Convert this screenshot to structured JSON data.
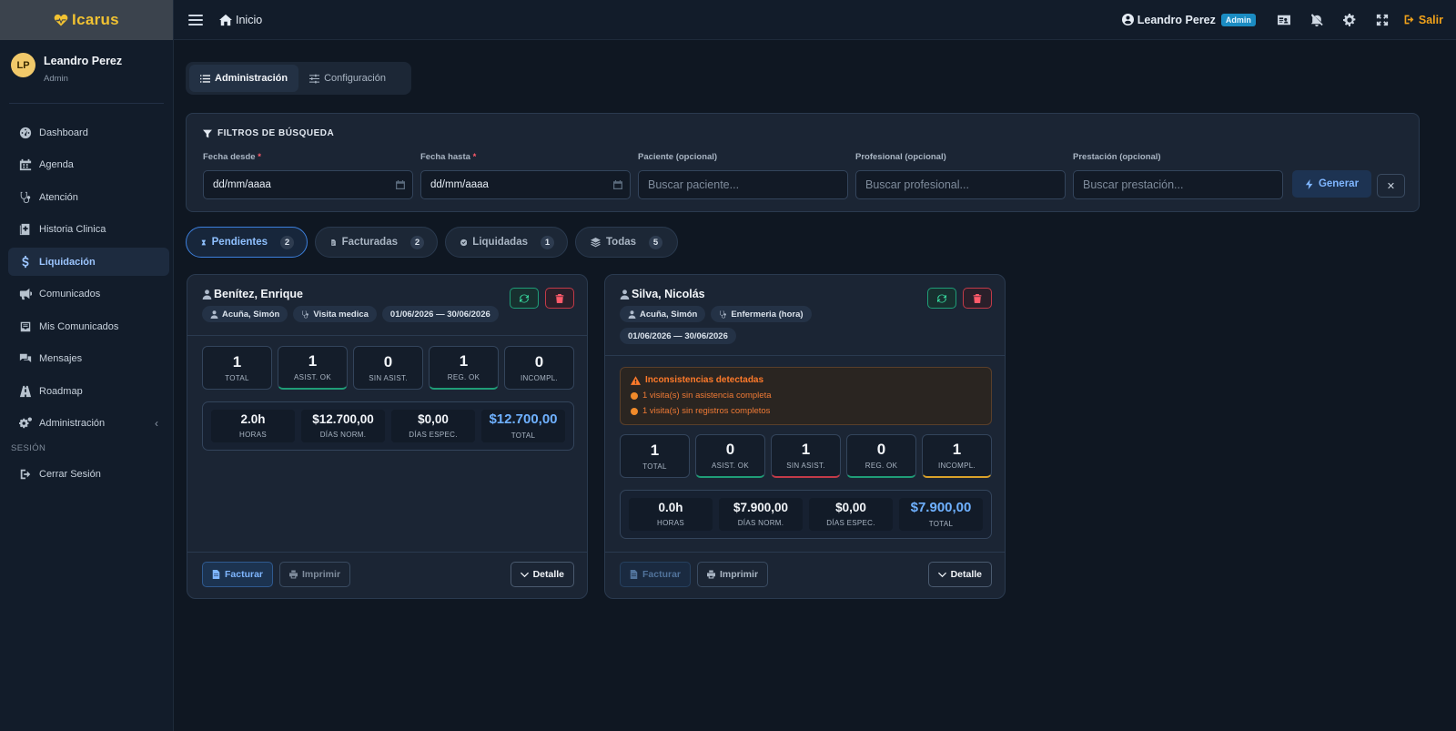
{
  "brand": {
    "name": "Icarus"
  },
  "sidebar": {
    "user": {
      "initials": "LP",
      "name": "Leandro Perez",
      "role": "Admin"
    },
    "items": [
      {
        "label": "Dashboard"
      },
      {
        "label": "Agenda"
      },
      {
        "label": "Atención"
      },
      {
        "label": "Historia Clinica"
      },
      {
        "label": "Liquidación"
      },
      {
        "label": "Comunicados"
      },
      {
        "label": "Mis Comunicados"
      },
      {
        "label": "Mensajes"
      },
      {
        "label": "Roadmap"
      },
      {
        "label": "Administración"
      }
    ],
    "session_label": "SESIÓN",
    "logout_label": "Cerrar Sesión"
  },
  "topbar": {
    "home_label": "Inicio",
    "user_name": "Leandro Perez",
    "user_badge": "Admin",
    "logout_label": "Salir"
  },
  "section_tabs": [
    {
      "label": "Administración"
    },
    {
      "label": "Configuración"
    }
  ],
  "filters": {
    "title": "FILTROS DE BÚSQUEDA",
    "fecha_desde": {
      "label": "Fecha desde",
      "value": "dd/mm/aaaa"
    },
    "fecha_hasta": {
      "label": "Fecha hasta",
      "value": "dd/mm/aaaa"
    },
    "paciente": {
      "label": "Paciente (opcional)",
      "placeholder": "Buscar paciente..."
    },
    "profesional": {
      "label": "Profesional (opcional)",
      "placeholder": "Buscar profesional..."
    },
    "prestacion": {
      "label": "Prestación (opcional)",
      "placeholder": "Buscar prestación..."
    },
    "generate_label": "Generar",
    "clear_label": "✕",
    "required_mark": "*"
  },
  "status_tabs": [
    {
      "label": "Pendientes",
      "count": "2"
    },
    {
      "label": "Facturadas",
      "count": "2"
    },
    {
      "label": "Liquidadas",
      "count": "1"
    },
    {
      "label": "Todas",
      "count": "5"
    }
  ],
  "cards": [
    {
      "patient": "Benítez, Enrique",
      "professional": "Acuña, Simón",
      "service": "Visita medica",
      "period": "01/06/2026 — 30/06/2026",
      "stats": [
        {
          "value": "1",
          "label": "TOTAL"
        },
        {
          "value": "1",
          "label": "ASIST. OK"
        },
        {
          "value": "0",
          "label": "SIN ASIST."
        },
        {
          "value": "1",
          "label": "REG. OK"
        },
        {
          "value": "0",
          "label": "INCOMPL."
        }
      ],
      "totals": [
        {
          "value": "2.0h",
          "label": "HORAS"
        },
        {
          "value": "$12.700,00",
          "label": "DÍAS NORM."
        },
        {
          "value": "$0,00",
          "label": "DÍAS ESPEC."
        },
        {
          "value": "$12.700,00",
          "label": "TOTAL"
        }
      ],
      "invoice_label": "Facturar",
      "print_label": "Imprimir",
      "detail_label": "Detalle"
    },
    {
      "patient": "Silva, Nicolás",
      "professional": "Acuña, Simón",
      "service": "Enfermeria (hora)",
      "period": "01/06/2026 — 30/06/2026",
      "alert": {
        "title": "Inconsistencias detectadas",
        "lines": [
          "1 visita(s) sin asistencia completa",
          "1 visita(s) sin registros completos"
        ]
      },
      "stats": [
        {
          "value": "1",
          "label": "TOTAL"
        },
        {
          "value": "0",
          "label": "ASIST. OK"
        },
        {
          "value": "1",
          "label": "SIN ASIST."
        },
        {
          "value": "0",
          "label": "REG. OK"
        },
        {
          "value": "1",
          "label": "INCOMPL."
        }
      ],
      "totals": [
        {
          "value": "0.0h",
          "label": "HORAS"
        },
        {
          "value": "$7.900,00",
          "label": "DÍAS NORM."
        },
        {
          "value": "$0,00",
          "label": "DÍAS ESPEC."
        },
        {
          "value": "$7.900,00",
          "label": "TOTAL"
        }
      ],
      "invoice_label": "Facturar",
      "print_label": "Imprimir",
      "detail_label": "Detalle"
    }
  ],
  "colors": {
    "accent": "#3c7fdc",
    "brand": "#f1c232",
    "warning": "#ff7a2a",
    "danger": "#ff5a6a",
    "success": "#36d39a"
  }
}
